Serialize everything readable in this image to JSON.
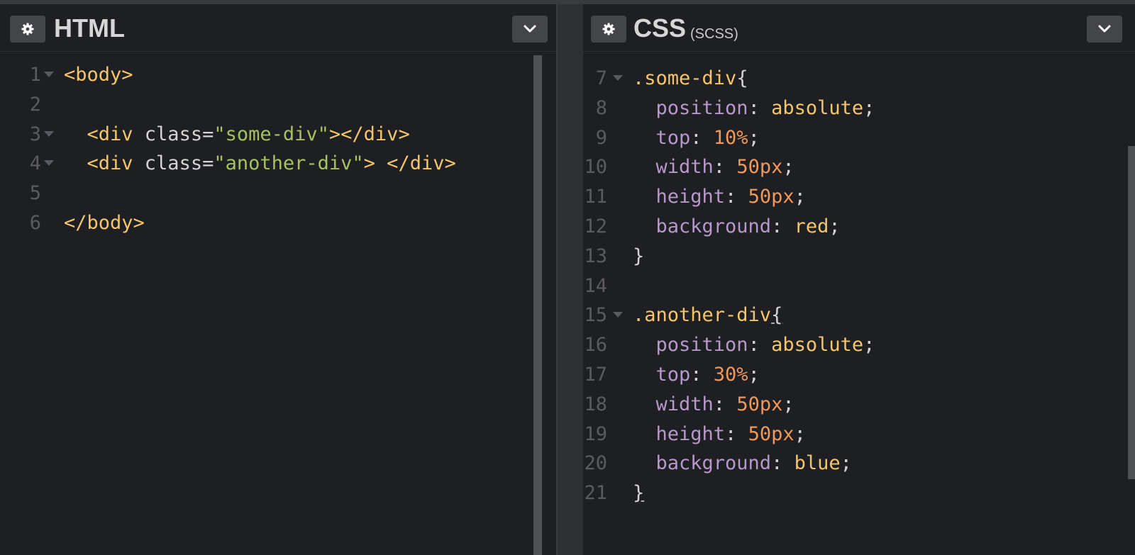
{
  "html_panel": {
    "title": "HTML",
    "settings_icon": "gear-icon",
    "collapse_icon": "chevron-down-icon",
    "lines": [
      {
        "n": "1",
        "fold": true,
        "tokens": [
          {
            "t": "tag",
            "v": "<body>"
          }
        ]
      },
      {
        "n": "2",
        "fold": false,
        "tokens": []
      },
      {
        "n": "3",
        "fold": true,
        "tokens": [
          {
            "t": "tag",
            "v": "  <div "
          },
          {
            "t": "attr",
            "v": "class="
          },
          {
            "t": "str",
            "v": "\"some-div\""
          },
          {
            "t": "tag",
            "v": "></div>"
          }
        ]
      },
      {
        "n": "4",
        "fold": true,
        "tokens": [
          {
            "t": "tag",
            "v": "  <div "
          },
          {
            "t": "attr",
            "v": "class="
          },
          {
            "t": "str",
            "v": "\"another-div\""
          },
          {
            "t": "tag",
            "v": "> </div>"
          }
        ]
      },
      {
        "n": "5",
        "fold": false,
        "tokens": []
      },
      {
        "n": "6",
        "fold": false,
        "tokens": [
          {
            "t": "tag",
            "v": "</body>"
          }
        ]
      }
    ]
  },
  "css_panel": {
    "title": "CSS",
    "subtitle": "(SCSS)",
    "settings_icon": "gear-icon",
    "collapse_icon": "chevron-down-icon",
    "lines": [
      {
        "n": "7",
        "fold": true,
        "tokens": [
          {
            "t": "sel",
            "v": ".some-div"
          },
          {
            "t": "brace",
            "v": "{"
          }
        ]
      },
      {
        "n": "8",
        "fold": false,
        "tokens": [
          {
            "t": "prop",
            "v": "  position"
          },
          {
            "t": "punc",
            "v": ": "
          },
          {
            "t": "val",
            "v": "absolute"
          },
          {
            "t": "punc",
            "v": ";"
          }
        ]
      },
      {
        "n": "9",
        "fold": false,
        "tokens": [
          {
            "t": "prop",
            "v": "  top"
          },
          {
            "t": "punc",
            "v": ": "
          },
          {
            "t": "num",
            "v": "10%"
          },
          {
            "t": "punc",
            "v": ";"
          }
        ]
      },
      {
        "n": "10",
        "fold": false,
        "tokens": [
          {
            "t": "prop",
            "v": "  width"
          },
          {
            "t": "punc",
            "v": ": "
          },
          {
            "t": "num",
            "v": "50px"
          },
          {
            "t": "punc",
            "v": ";"
          }
        ]
      },
      {
        "n": "11",
        "fold": false,
        "tokens": [
          {
            "t": "prop",
            "v": "  height"
          },
          {
            "t": "punc",
            "v": ": "
          },
          {
            "t": "num",
            "v": "50px"
          },
          {
            "t": "punc",
            "v": ";"
          }
        ]
      },
      {
        "n": "12",
        "fold": false,
        "tokens": [
          {
            "t": "prop",
            "v": "  background"
          },
          {
            "t": "punc",
            "v": ": "
          },
          {
            "t": "val",
            "v": "red"
          },
          {
            "t": "punc",
            "v": ";"
          }
        ]
      },
      {
        "n": "13",
        "fold": false,
        "tokens": [
          {
            "t": "brace",
            "v": "}"
          }
        ]
      },
      {
        "n": "14",
        "fold": false,
        "tokens": []
      },
      {
        "n": "15",
        "fold": true,
        "tokens": [
          {
            "t": "sel",
            "v": ".another-div"
          },
          {
            "t": "brace-u",
            "v": "{"
          }
        ]
      },
      {
        "n": "16",
        "fold": false,
        "tokens": [
          {
            "t": "prop",
            "v": "  position"
          },
          {
            "t": "punc",
            "v": ": "
          },
          {
            "t": "val",
            "v": "absolute"
          },
          {
            "t": "punc",
            "v": ";"
          }
        ]
      },
      {
        "n": "17",
        "fold": false,
        "tokens": [
          {
            "t": "prop",
            "v": "  top"
          },
          {
            "t": "punc",
            "v": ": "
          },
          {
            "t": "num",
            "v": "30%"
          },
          {
            "t": "punc",
            "v": ";"
          }
        ]
      },
      {
        "n": "18",
        "fold": false,
        "tokens": [
          {
            "t": "prop",
            "v": "  width"
          },
          {
            "t": "punc",
            "v": ": "
          },
          {
            "t": "num",
            "v": "50px"
          },
          {
            "t": "punc",
            "v": ";"
          }
        ]
      },
      {
        "n": "19",
        "fold": false,
        "tokens": [
          {
            "t": "prop",
            "v": "  height"
          },
          {
            "t": "punc",
            "v": ": "
          },
          {
            "t": "num",
            "v": "50px"
          },
          {
            "t": "punc",
            "v": ";"
          }
        ]
      },
      {
        "n": "20",
        "fold": false,
        "tokens": [
          {
            "t": "prop",
            "v": "  background"
          },
          {
            "t": "punc",
            "v": ": "
          },
          {
            "t": "val",
            "v": "blue"
          },
          {
            "t": "punc",
            "v": ";"
          }
        ]
      },
      {
        "n": "21",
        "fold": false,
        "tokens": [
          {
            "t": "brace-u",
            "v": "}"
          }
        ]
      }
    ]
  },
  "colors": {
    "tag": "#f5c56b",
    "string": "#a6c15f",
    "property": "#b699c8",
    "number": "#f0985a",
    "background": "#1e1f22"
  }
}
